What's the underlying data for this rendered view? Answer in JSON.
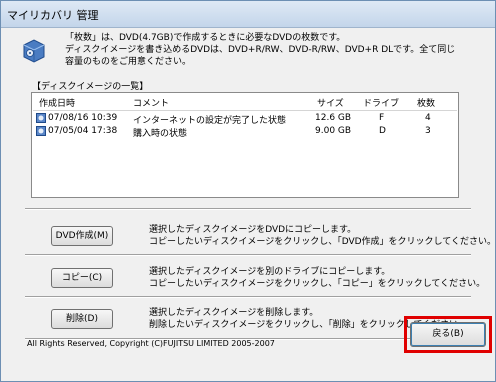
{
  "window": {
    "title": "マイリカバリ 管理"
  },
  "description": {
    "lines": [
      "「枚数」は、DVD(4.7GB)で作成するときに必要なDVDの枚数です。",
      "ディスクイメージを書き込めるDVDは、DVD+R/RW、DVD-R/RW、DVD+R DLです。全て同じ",
      "容量のものをご用意ください。"
    ]
  },
  "image_list": {
    "label": "【ディスクイメージの一覧】",
    "columns": [
      "作成日時",
      "コメント",
      "サイズ",
      "ドライブ",
      "枚数"
    ],
    "rows": [
      {
        "date": "07/08/16 10:39",
        "comment": "インターネットの設定が完了した状態",
        "size": "12.6 GB",
        "drive": "F",
        "count": "4"
      },
      {
        "date": "07/05/04 17:38",
        "comment": "購入時の状態",
        "size": "9.00 GB",
        "drive": "D",
        "count": "3"
      }
    ]
  },
  "actions": {
    "dvd": {
      "label": "DVD作成(M)",
      "desc": [
        "選択したディスクイメージをDVDにコピーします。",
        "コピーしたいディスクイメージをクリックし、「DVD作成」をクリックしてください。"
      ]
    },
    "copy": {
      "label": "コピー(C)",
      "desc": [
        "選択したディスクイメージを別のドライブにコピーします。",
        "コピーしたいディスクイメージをクリックし、「コピー」をクリックしてください。"
      ]
    },
    "delete": {
      "label": "削除(D)",
      "desc": [
        "選択したディスクイメージを削除します。",
        "削除したいディスクイメージをクリックし、「削除」をクリックしてください。"
      ]
    }
  },
  "footer": {
    "copyright": "All Rights Reserved, Copyright (C)FUJITSU LIMITED 2005-2007",
    "back_label": "戻る(B)"
  },
  "colors": {
    "highlight": "#e00000",
    "title_bar": "#c3d5ea"
  },
  "icons": {
    "app": "recovery-disc-icon",
    "row": "disc-image-icon"
  }
}
